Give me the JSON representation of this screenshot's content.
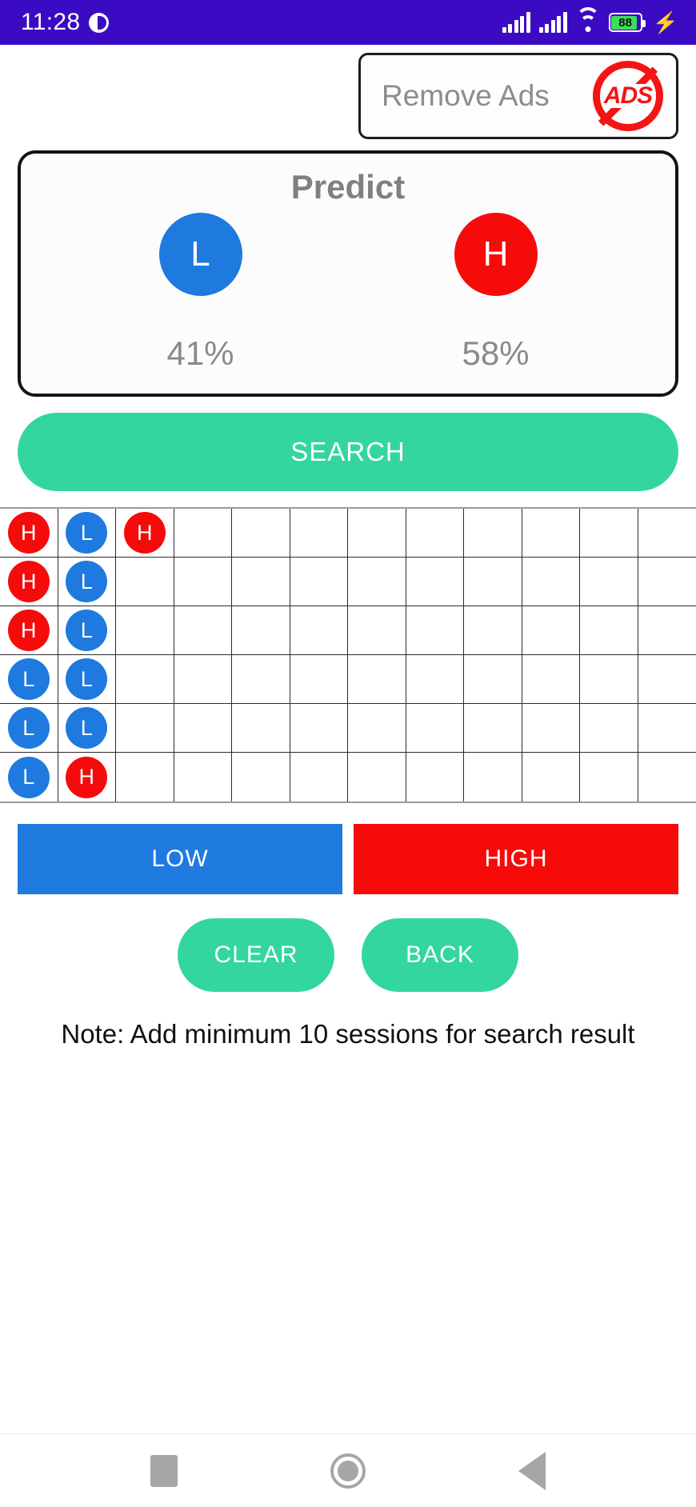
{
  "statusbar": {
    "time": "11:28",
    "battery_level": "88",
    "dnd_icon": "do-not-disturb-icon",
    "signal_icon": "cellular-signal-icon",
    "wifi_icon": "wifi-icon",
    "charging_icon": "⚡",
    "background_color": "#3b0bc4"
  },
  "remove_ads": {
    "label": "Remove Ads",
    "icon_text": "ADS",
    "icon_color": "#f41414"
  },
  "predict": {
    "title": "Predict",
    "low": {
      "letter": "L",
      "percent": "41%",
      "color": "#1f7ae0"
    },
    "high": {
      "letter": "H",
      "percent": "58%",
      "color": "#f60b0b"
    }
  },
  "search": {
    "label": "SEARCH",
    "color": "#34d6a0"
  },
  "grid": {
    "columns": 12,
    "rows": [
      [
        "H",
        "L",
        "H",
        "",
        "",
        "",
        "",
        "",
        "",
        "",
        "",
        ""
      ],
      [
        "H",
        "L",
        "",
        "",
        "",
        "",
        "",
        "",
        "",
        "",
        "",
        ""
      ],
      [
        "H",
        "L",
        "",
        "",
        "",
        "",
        "",
        "",
        "",
        "",
        "",
        ""
      ],
      [
        "L",
        "L",
        "",
        "",
        "",
        "",
        "",
        "",
        "",
        "",
        "",
        ""
      ],
      [
        "L",
        "L",
        "",
        "",
        "",
        "",
        "",
        "",
        "",
        "",
        "",
        ""
      ],
      [
        "L",
        "H",
        "",
        "",
        "",
        "",
        "",
        "",
        "",
        "",
        "",
        ""
      ]
    ]
  },
  "entry_buttons": {
    "low": {
      "label": "LOW",
      "color": "#1f7ae0"
    },
    "high": {
      "label": "HIGH",
      "color": "#f60b0b"
    }
  },
  "actions": {
    "clear": "CLEAR",
    "back": "BACK"
  },
  "note": "Note: Add minimum 10 sessions for search result",
  "navbar": {
    "recents_icon": "square-icon",
    "home_icon": "circle-icon",
    "back_icon": "triangle-left-icon"
  }
}
